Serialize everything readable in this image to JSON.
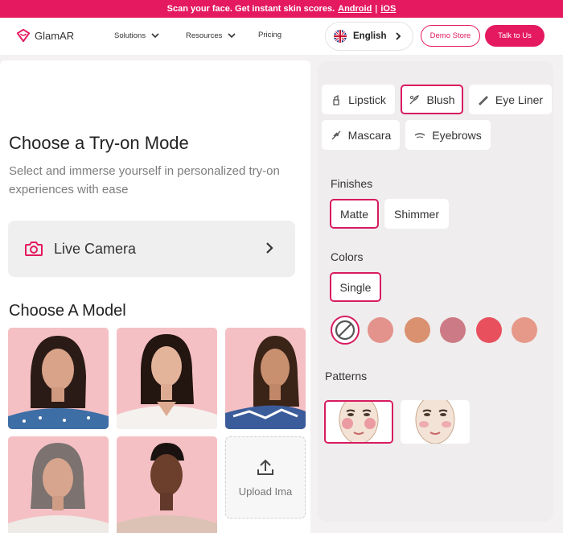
{
  "banner": {
    "text": "Scan your face. Get instant skin scores.",
    "android": "Android",
    "sep": "|",
    "ios": "iOS"
  },
  "nav": {
    "brand": "GlamAR",
    "solutions": "Solutions",
    "resources": "Resources",
    "pricing": "Pricing",
    "language": "English",
    "demo": "Demo Store",
    "talk": "Talk to Us"
  },
  "left": {
    "title": "Choose a Try-on Mode",
    "subtitle": "Select and immerse yourself in personalized try-on experiences with ease",
    "live_camera": "Live Camera",
    "model_title": "Choose A Model",
    "upload": "Upload Ima"
  },
  "right": {
    "categories": [
      "Lipstick",
      "Blush",
      "Eye Liner",
      "Mascara",
      "Eyebrows"
    ],
    "selected_category": "Blush",
    "finishes_label": "Finishes",
    "finishes": [
      "Matte",
      "Shimmer"
    ],
    "colors_label": "Colors",
    "color_mode": "Single",
    "swatches": [
      "#e3928c",
      "#da9170",
      "#cc7a85",
      "#e8505e",
      "#e69988"
    ],
    "patterns_label": "Patterns"
  },
  "colors": {
    "accent": "#e4195f",
    "panel": "#efeded"
  }
}
